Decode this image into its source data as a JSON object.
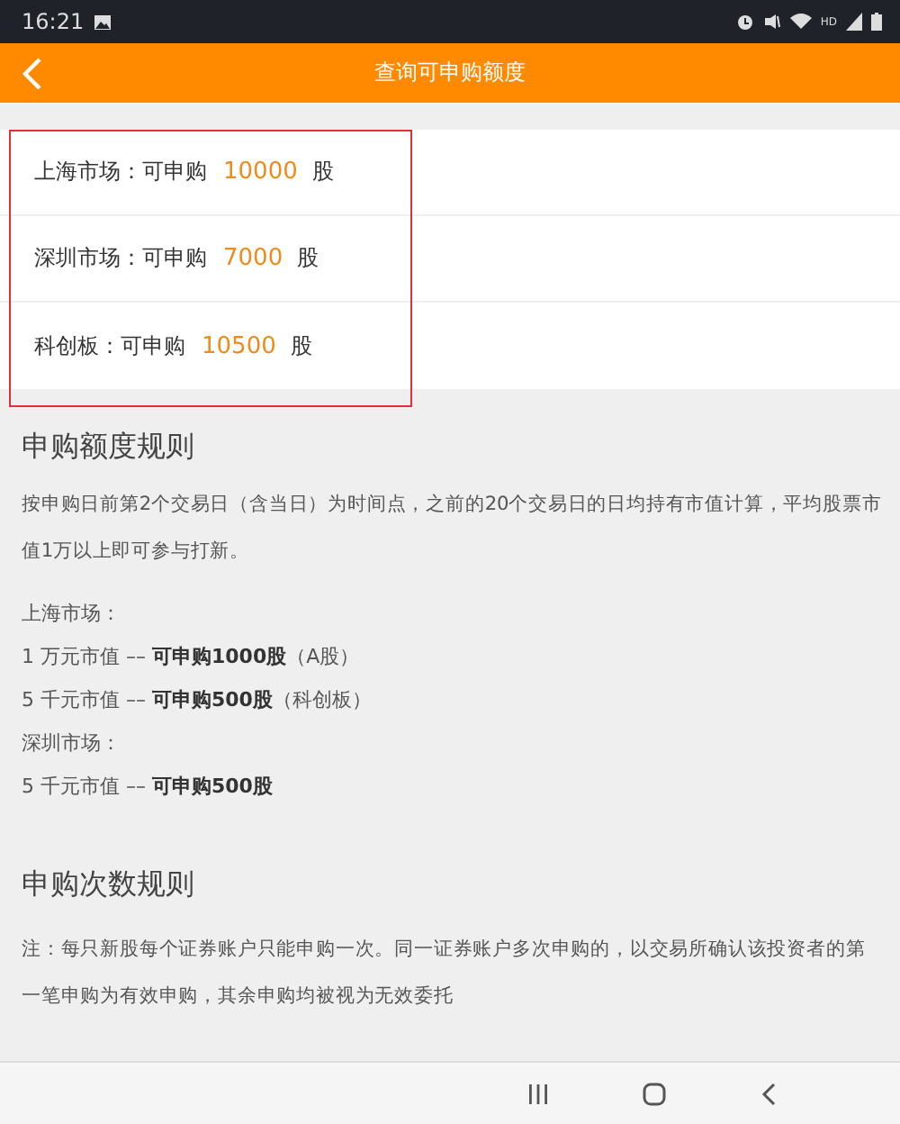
{
  "status_bar": {
    "time": "16:21",
    "hd": "HD"
  },
  "header": {
    "title": "查询可申购额度"
  },
  "quota": {
    "highlighted": true,
    "rows": [
      {
        "market": "上海市场：可申购",
        "amount": "10000",
        "unit": "股"
      },
      {
        "market": "深圳市场：可申购",
        "amount": "7000",
        "unit": "股"
      },
      {
        "market": "科创板：可申购",
        "amount": "10500",
        "unit": "股"
      }
    ]
  },
  "sections": [
    {
      "title": "申购额度规则",
      "lines": [
        {
          "text": "按申购日前第2个交易日（含当日）为时间点，之前的20个交易日的日均持有市值计算，平均股票市值1万以上即可参与打新。",
          "kind": "paragraph"
        },
        {
          "text": "上海市场：",
          "kind": "line"
        },
        {
          "text": "1 万元市值 –– **可申购1000股**（A股）",
          "kind": "line"
        },
        {
          "text": "5 千元市值 –– **可申购500股**（科创板）",
          "kind": "line"
        },
        {
          "text": "深圳市场：",
          "kind": "line"
        },
        {
          "text": "5 千元市值 –– **可申购500股**",
          "kind": "line"
        }
      ]
    },
    {
      "title": "申购次数规则",
      "lines": [
        {
          "text": "注：每只新股每个证券账户只能申购一次。同一证券账户多次申购的，以交易所确认该投资者的第一笔申购为有效申购，其余申购均被视为无效委托",
          "kind": "paragraph"
        }
      ]
    }
  ]
}
